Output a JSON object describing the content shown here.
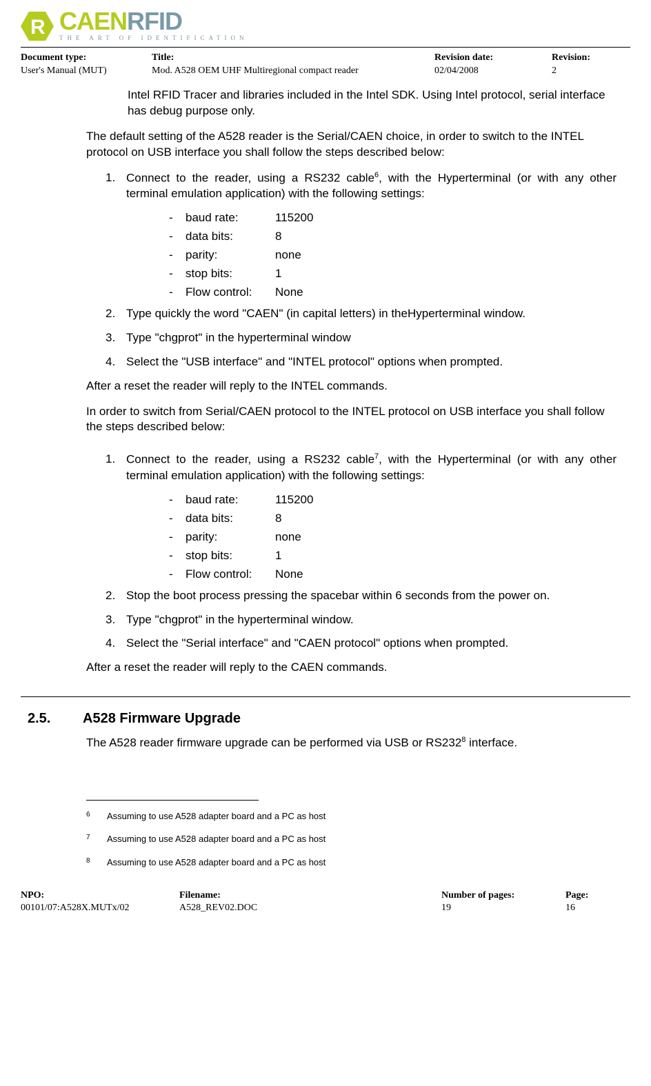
{
  "logo": {
    "brand_left": "CAEN",
    "brand_right": "RFID",
    "tagline": "THE ART OF IDENTIFICATION",
    "mark_letter": "R"
  },
  "meta": {
    "doc_type_label": "Document type:",
    "doc_type_value": "User's Manual (MUT)",
    "title_label": "Title:",
    "title_value": "Mod. A528 OEM UHF Multiregional compact reader",
    "rev_date_label": "Revision date:",
    "rev_date_value": "02/04/2008",
    "rev_label": "Revision:",
    "rev_value": "2"
  },
  "intro1": "Intel RFID Tracer and libraries included in the Intel SDK. Using Intel protocol, serial interface has debug purpose only.",
  "intro2": "The default setting of the A528 reader is the Serial/CAEN choice, in order to switch to the INTEL protocol on USB interface you shall follow the steps described below:",
  "stepsA": {
    "s1_pre": "Connect to the reader, using a RS232 cable",
    "s1_sup": "6",
    "s1_post": ", with the Hyperterminal  (or with any other terminal emulation application) with the following  settings:",
    "s2": "Type quickly the word \"CAEN\" (in capital letters) in theHyperterminal window.",
    "s3": "Type \"chgprot\" in the hyperterminal window",
    "s4": "Select the \"USB interface\" and \"INTEL protocol\" options when prompted."
  },
  "settings": [
    {
      "key": "baud rate:",
      "val": "115200"
    },
    {
      "key": "data bits:",
      "val": "8"
    },
    {
      "key": "parity:",
      "val": "none"
    },
    {
      "key": "stop bits:",
      "val": "1"
    },
    {
      "key": "Flow control:",
      "val": "None"
    }
  ],
  "afterA": "After a reset the reader will reply to the INTEL commands.",
  "intro3": "In order to switch from Serial/CAEN protocol to the INTEL protocol on USB interface you shall follow the steps described below:",
  "stepsB": {
    "s1_pre": "Connect to the reader, using a RS232 cable",
    "s1_sup": "7",
    "s1_post": ", with the Hyperterminal (or with any other terminal emulation application) with the following settings:",
    "s2": "Stop the boot process pressing the spacebar within 6 seconds  from the power on.",
    "s3": "Type \"chgprot\" in the hyperterminal window.",
    "s4": "Select the \"Serial interface\" and \"CAEN protocol\" options when prompted."
  },
  "afterB": "After a reset the reader will reply to the CAEN commands.",
  "section": {
    "num": "2.5.",
    "title": "A528 Firmware Upgrade",
    "body_pre": "The A528 reader firmware upgrade can be performed via USB or RS232",
    "body_sup": "8",
    "body_post": " interface."
  },
  "footnotes": [
    {
      "num": "6",
      "text": "Assuming to use A528 adapter board and a PC as host"
    },
    {
      "num": "7",
      "text": "Assuming to use A528 adapter board and a PC as host"
    },
    {
      "num": "8",
      "text": "Assuming to use A528 adapter board and a PC as host"
    }
  ],
  "footer": {
    "npo_label": "NPO:",
    "npo_value": "00101/07:A528X.MUTx/02",
    "filename_label": "Filename:",
    "filename_value": "A528_REV02.DOC",
    "pages_label": "Number of pages:",
    "pages_value": "19",
    "page_label": "Page:",
    "page_value": "16"
  }
}
